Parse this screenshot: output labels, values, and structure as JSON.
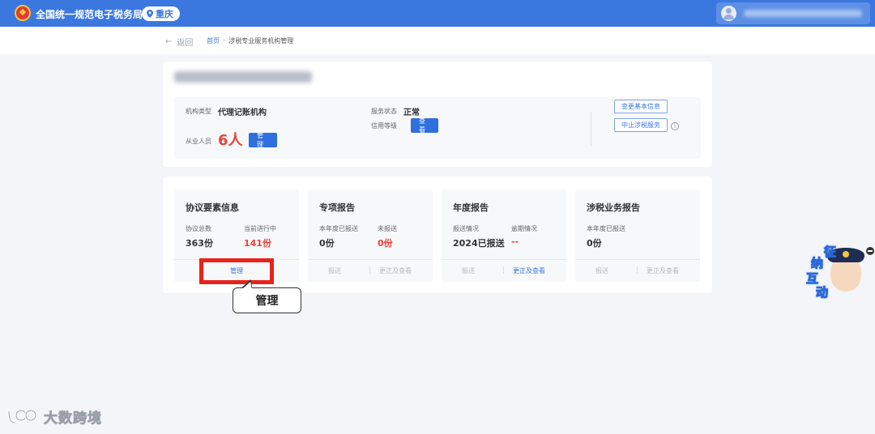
{
  "header": {
    "app_title": "全国统一规范电子税务局",
    "region": "重庆"
  },
  "nav": {
    "back_label": "返回",
    "breadcrumb": [
      "首页",
      "涉税专业服务机构管理"
    ]
  },
  "org": {
    "type_label": "机构类型",
    "type_value": "代理记账机构",
    "staff_label": "从业人员",
    "staff_value": "6人",
    "staff_button": "管理",
    "status_label": "服务状态",
    "status_value": "正常",
    "credit_label": "信用等级",
    "credit_button": "查看",
    "change_info_button": "变更基本信息",
    "stop_service_button": "中止涉税服务"
  },
  "cards": [
    {
      "title": "协议要素信息",
      "stats": [
        {
          "label": "协议总数",
          "value": "363份",
          "color": "#333333"
        },
        {
          "label": "当前进行中",
          "value": "141份",
          "color": "#e8433a"
        }
      ],
      "actions": [
        "管理"
      ]
    },
    {
      "title": "专项报告",
      "stats": [
        {
          "label": "本年度已报送",
          "value": "0份",
          "color": "#333333"
        },
        {
          "label": "未报送",
          "value": "0份",
          "color": "#e8433a"
        }
      ],
      "actions": [
        "报送",
        "更正及查看"
      ]
    },
    {
      "title": "年度报告",
      "stats": [
        {
          "label": "报送情况",
          "value": "2024已报送",
          "color": "#333333"
        },
        {
          "label": "逾期情况",
          "value": "--",
          "color": "#e8433a"
        }
      ],
      "actions": [
        "报送",
        "更正及查看"
      ]
    },
    {
      "title": "涉税业务报告",
      "stats": [
        {
          "label": "本年度已报送",
          "value": "0份",
          "color": "#333333"
        }
      ],
      "actions": [
        "报送",
        "更正及查看"
      ]
    }
  ],
  "callout": {
    "label": "管理"
  },
  "mascot": {
    "chars": [
      "征",
      "纳",
      "互",
      "动"
    ]
  },
  "watermark": {
    "text": "大数跨境"
  },
  "colors": {
    "primary": "#3a78e0",
    "highlight": "#e8231c",
    "danger": "#e8433a"
  }
}
